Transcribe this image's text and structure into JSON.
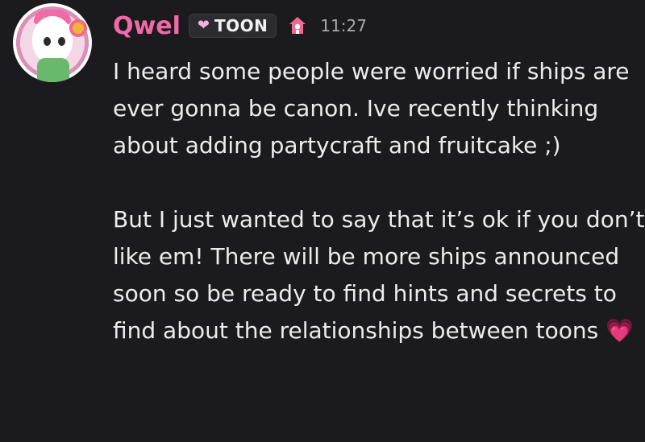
{
  "message": {
    "username": "Qwel",
    "tag": {
      "heart_icon": "heart-icon",
      "label": "TOON"
    },
    "badge_icon": "pink-house-icon",
    "timestamp": "11:27",
    "paragraph1": "I heard some people were worried if ships are ever gonna be canon. Ive recently thinking about adding partycraft and fruitcake ;)",
    "paragraph2": "But I just wanted to say that it’s ok if you don’t like em! There will be more ships announced soon so be ready to find hints and secrets to find about the relationships between toons",
    "emoji": "💗"
  },
  "colors": {
    "background": "#1b1b1f",
    "username": "#f06aa6",
    "text": "#ececee",
    "timestamp": "#a8a8ae"
  }
}
